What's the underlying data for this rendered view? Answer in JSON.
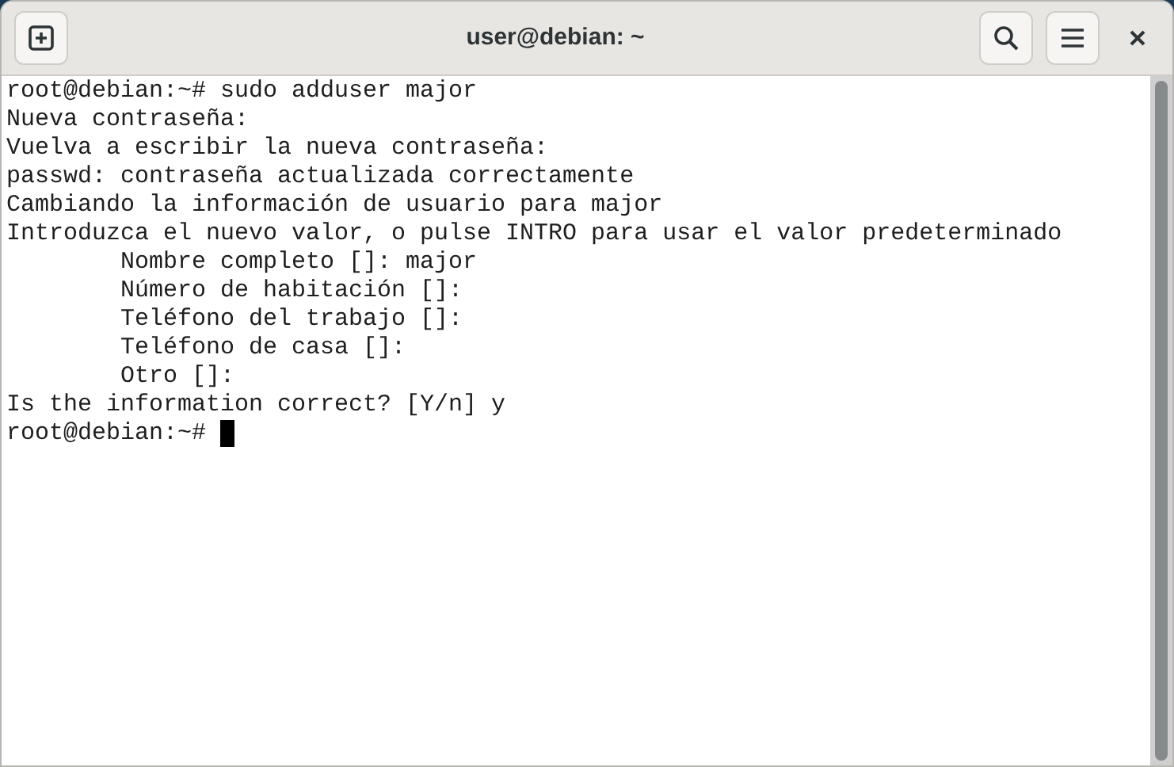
{
  "window": {
    "title": "user@debian: ~"
  },
  "terminal": {
    "lines": [
      "root@debian:~# sudo adduser major",
      "Nueva contraseña:",
      "Vuelva a escribir la nueva contraseña:",
      "passwd: contraseña actualizada correctamente",
      "Cambiando la información de usuario para major",
      "Introduzca el nuevo valor, o pulse INTRO para usar el valor predeterminado",
      "        Nombre completo []: major",
      "        Número de habitación []:",
      "        Teléfono del trabajo []:",
      "        Teléfono de casa []:",
      "        Otro []:",
      "Is the information correct? [Y/n] y",
      "root@debian:~# "
    ]
  }
}
